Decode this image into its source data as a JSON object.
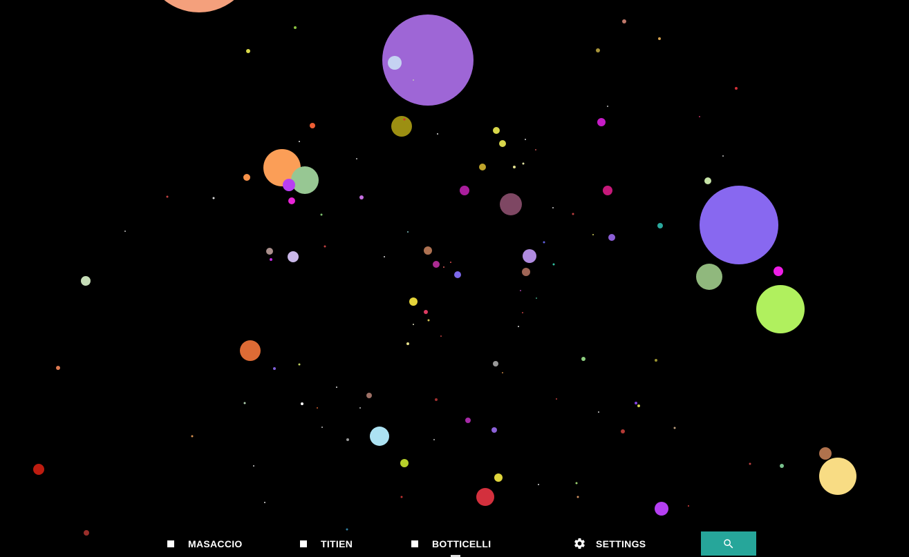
{
  "nav": {
    "items": [
      {
        "label": "MASACCIO"
      },
      {
        "label": "TITIEN"
      },
      {
        "label": "BOTTICELLI"
      }
    ],
    "settings_label": "SETTINGS"
  },
  "search": {
    "icon": "search-icon",
    "color": "#26a69a"
  },
  "colors": {
    "background": "#000000",
    "text": "#ffffff"
  }
}
